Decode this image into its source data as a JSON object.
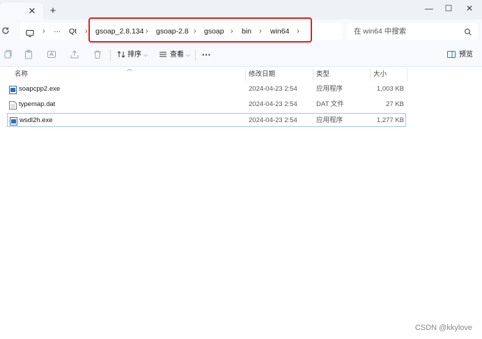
{
  "window": {
    "tab_close": "✕",
    "new_tab": "+",
    "minimize": "—",
    "maximize": "☐",
    "close": "✕"
  },
  "address": {
    "overflow": "···",
    "crumbs": [
      "Qt",
      "gsoap_2.8.134",
      "gsoap-2.8",
      "gsoap",
      "bin",
      "win64"
    ],
    "separator": "›"
  },
  "search": {
    "placeholder": "在 win64 中搜索"
  },
  "toolbar": {
    "sort_label": "排序",
    "view_label": "查看",
    "more_label": "···",
    "preview_label": "预览"
  },
  "columns": {
    "name": "名称",
    "modified": "修改日期",
    "type": "类型",
    "size": "大小"
  },
  "files": [
    {
      "name": "soapcpp2.exe",
      "modified": "2024-04-23 2:54",
      "type": "应用程序",
      "size": "1,003 KB",
      "icon": "exe-icon"
    },
    {
      "name": "typemap.dat",
      "modified": "2024-04-23 2:54",
      "type": "DAT 文件",
      "size": "27 KB",
      "icon": "file-icon"
    },
    {
      "name": "wsdl2h.exe",
      "modified": "2024-04-23 2:54",
      "type": "应用程序",
      "size": "1,277 KB",
      "icon": "exe-icon",
      "selected": true
    }
  ],
  "watermark": "CSDN @kkylove",
  "colors": {
    "highlight": "#e0201b",
    "selection": "#9fc6ec",
    "chrome": "#f7f9fc"
  }
}
